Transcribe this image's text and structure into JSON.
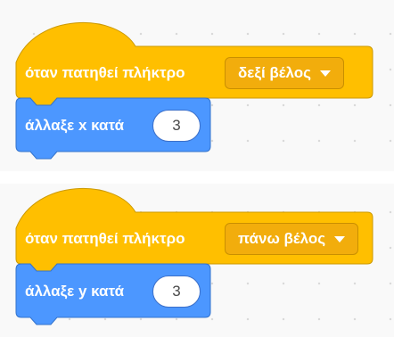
{
  "scripts": [
    {
      "hat": {
        "label": "όταν πατηθεί πλήκτρο",
        "dropdown_value": "δεξί βέλος",
        "dropdown_icon": "chevron-down-icon"
      },
      "motion": {
        "label": "άλλαξε x κατά",
        "value": "3"
      }
    },
    {
      "hat": {
        "label": "όταν πατηθεί πλήκτρο",
        "dropdown_value": "πάνω βέλος",
        "dropdown_icon": "chevron-down-icon"
      },
      "motion": {
        "label": "άλλαξε y κατά",
        "value": "3"
      }
    }
  ],
  "colors": {
    "events": "#ffbf00",
    "events_border": "#cc9900",
    "motion": "#4c97ff",
    "motion_border": "#3373cc",
    "canvas": "#f9f9f9"
  }
}
